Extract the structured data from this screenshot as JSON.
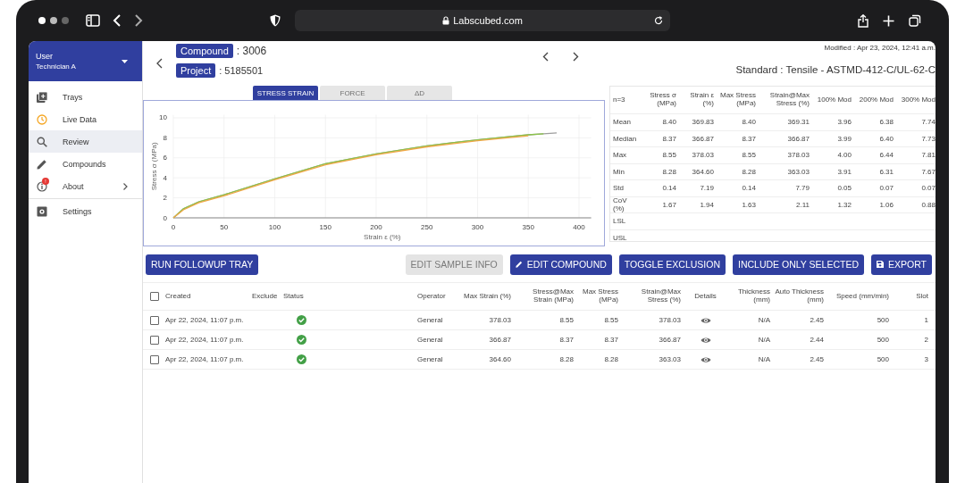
{
  "browser": {
    "url": "Labscubed.com"
  },
  "user": {
    "name": "User",
    "role": "Technician A"
  },
  "nav": [
    {
      "label": "Trays",
      "selected": false,
      "expandable": false
    },
    {
      "label": "Live Data",
      "selected": false,
      "expandable": false
    },
    {
      "label": "Review",
      "selected": true,
      "expandable": false
    },
    {
      "label": "Compounds",
      "selected": false,
      "expandable": false
    },
    {
      "label": "About",
      "selected": false,
      "expandable": true,
      "badge": "!"
    },
    {
      "label": "Settings",
      "selected": false,
      "expandable": false
    }
  ],
  "compound": {
    "label": "Compound",
    "value": ": 3006"
  },
  "project": {
    "label": "Project",
    "value": ": 5185501"
  },
  "modified": "Modified : Apr 23, 2024, 12:41 a.m.",
  "standard": "Standard : Tensile - ASTMD-412-C/UL-62-C",
  "chart_tabs": [
    {
      "label": "STRESS STRAIN",
      "selected": true
    },
    {
      "label": "FORCE",
      "selected": false
    },
    {
      "label": "ΔD",
      "selected": false
    }
  ],
  "chart_data": {
    "type": "line",
    "grid": true,
    "xlabel": "Strain ε (%)",
    "ylabel": "Stress σ (MPa)",
    "x": [
      0,
      10,
      25,
      50,
      100,
      150,
      200,
      250,
      300,
      350,
      365,
      378
    ],
    "series": [
      {
        "color": "#9e9e9e",
        "values": [
          0,
          0.9,
          1.6,
          2.3,
          3.9,
          5.4,
          6.4,
          7.2,
          7.8,
          8.3,
          8.4,
          8.5
        ]
      },
      {
        "color": "#8bc34a",
        "values": [
          0,
          0.9,
          1.6,
          2.3,
          3.9,
          5.4,
          6.4,
          7.2,
          7.8,
          8.3,
          8.4,
          null
        ]
      },
      {
        "color": "#f0a848",
        "values": [
          0,
          0.8,
          1.5,
          2.2,
          3.8,
          5.3,
          6.3,
          7.1,
          7.7,
          8.2,
          null,
          null
        ]
      }
    ],
    "xlim": [
      0,
      412
    ],
    "ylim": [
      0,
      10.3
    ],
    "xticks": [
      0,
      50,
      100,
      150,
      200,
      250,
      300,
      350,
      400
    ],
    "yticks": [
      0,
      2,
      4,
      6,
      8,
      10
    ]
  },
  "stats": {
    "columns": [
      "n=3",
      "Stress σ (MPa)",
      "Strain ε (%)",
      "Max Stress (MPa)",
      "Strain@Max Stress (%)",
      "100% Mod",
      "200% Mod",
      "300% Mod"
    ],
    "rows": [
      {
        "label": "Mean",
        "values": [
          "8.40",
          "369.83",
          "8.40",
          "369.31",
          "3.96",
          "6.38",
          "7.74"
        ]
      },
      {
        "label": "Median",
        "values": [
          "8.37",
          "366.87",
          "8.37",
          "366.87",
          "3.99",
          "6.40",
          "7.73"
        ]
      },
      {
        "label": "Max",
        "values": [
          "8.55",
          "378.03",
          "8.55",
          "378.03",
          "4.00",
          "6.44",
          "7.81"
        ]
      },
      {
        "label": "Min",
        "values": [
          "8.28",
          "364.60",
          "8.28",
          "363.03",
          "3.91",
          "6.31",
          "7.67"
        ]
      },
      {
        "label": "Std",
        "values": [
          "0.14",
          "7.19",
          "0.14",
          "7.79",
          "0.05",
          "0.07",
          "0.07"
        ]
      },
      {
        "label": "CoV (%)",
        "values": [
          "1.67",
          "1.94",
          "1.63",
          "2.11",
          "1.32",
          "1.06",
          "0.88"
        ]
      },
      {
        "label": "LSL"
      },
      {
        "label": "USL"
      }
    ]
  },
  "actions": [
    {
      "label": "RUN FOLLOWUP TRAY",
      "disabled": false
    },
    {
      "label": "EDIT SAMPLE INFO",
      "disabled": true
    },
    {
      "label": "EDIT COMPOUND",
      "disabled": false
    },
    {
      "label": "TOGGLE EXCLUSION",
      "disabled": false
    },
    {
      "label": "INCLUDE ONLY SELECTED",
      "disabled": false
    },
    {
      "label": "EXPORT",
      "disabled": false
    }
  ],
  "samples": {
    "select_all": {
      "checked": false
    },
    "columns": [
      "Created",
      "Exclude",
      "Status",
      "Operator",
      "Max Strain (%)",
      "Stress@Max Strain (MPa)",
      "Max Stress (MPa)",
      "Strain@Max Stress (%)",
      "Details",
      "Thickness (mm)",
      "Auto Thickness (mm)",
      "Speed (mm/min)",
      "Slot"
    ],
    "rows": [
      {
        "checked": false,
        "created": "Apr 22, 2024, 11:07 p.m.",
        "passed": true,
        "operator": "General",
        "max_strain": "378.03",
        "stress_at_max_strain": "8.55",
        "max_stress": "8.55",
        "strain_at_max_stress": "378.03",
        "thickness": "N/A",
        "auto_thickness": "2.45",
        "speed": "500",
        "slot": "1"
      },
      {
        "checked": false,
        "created": "Apr 22, 2024, 11:07 p.m.",
        "passed": true,
        "operator": "General",
        "max_strain": "366.87",
        "stress_at_max_strain": "8.37",
        "max_stress": "8.37",
        "strain_at_max_stress": "366.87",
        "thickness": "N/A",
        "auto_thickness": "2.44",
        "speed": "500",
        "slot": "2"
      },
      {
        "checked": false,
        "created": "Apr 22, 2024, 11:07 p.m.",
        "passed": true,
        "operator": "General",
        "max_strain": "364.60",
        "stress_at_max_strain": "8.28",
        "max_stress": "8.28",
        "strain_at_max_stress": "363.03",
        "thickness": "N/A",
        "auto_thickness": "2.45",
        "speed": "500",
        "slot": "3"
      }
    ]
  }
}
